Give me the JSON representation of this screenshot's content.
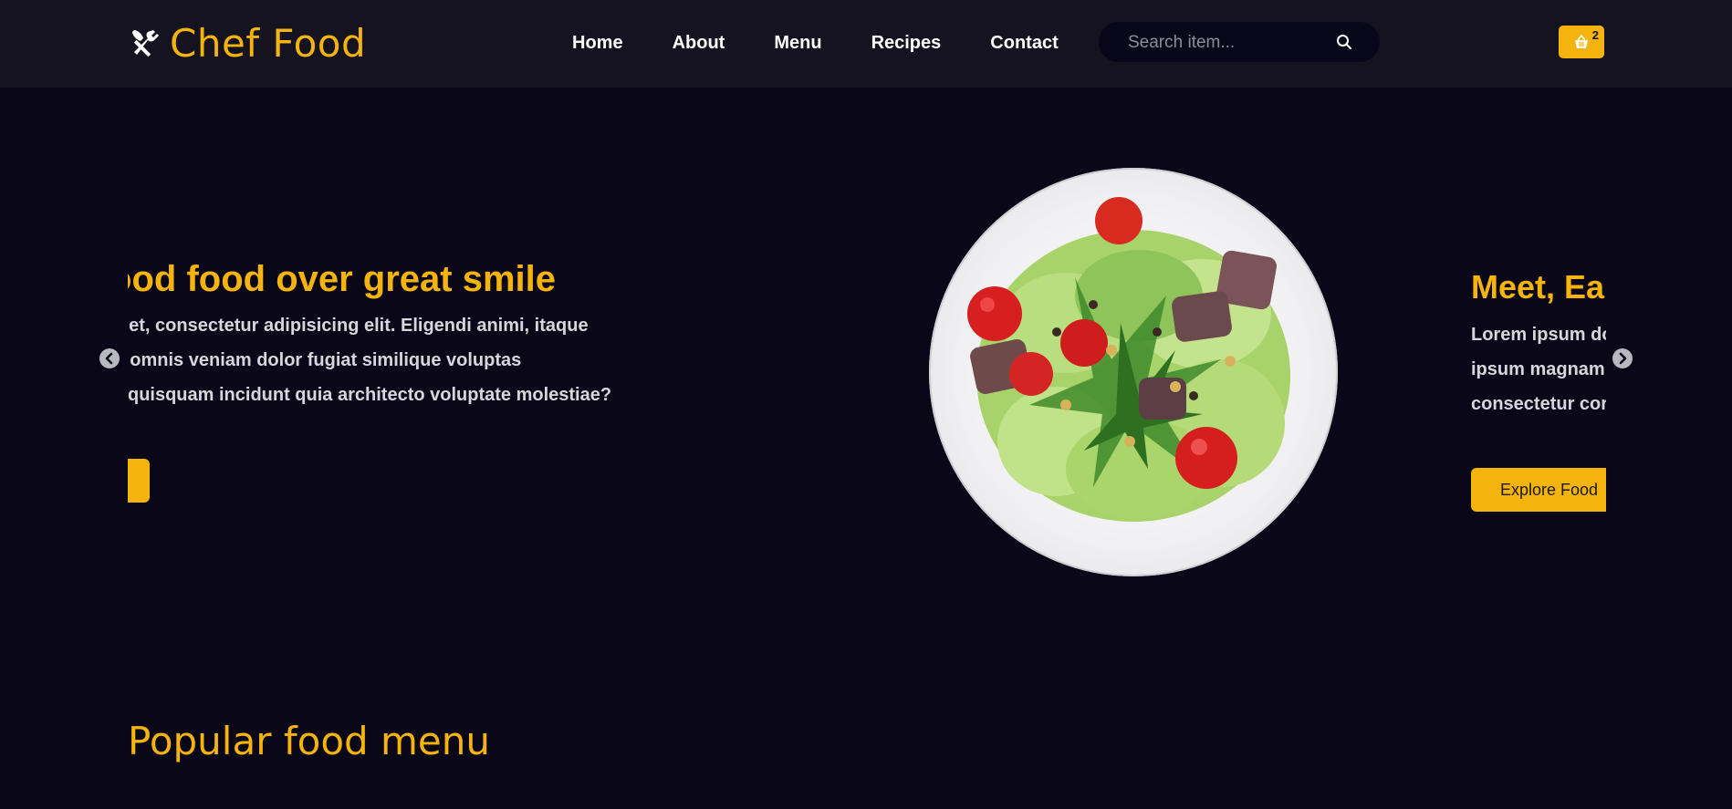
{
  "brand": {
    "name": "Chef Food",
    "icon": "fork-knife-icon"
  },
  "nav": {
    "links": [
      "Home",
      "About",
      "Menu",
      "Recipes",
      "Contact"
    ]
  },
  "search": {
    "placeholder": "Search item...",
    "icon": "search-icon"
  },
  "cart": {
    "icon": "basket-icon",
    "count": "2"
  },
  "slider": {
    "slides": [
      {
        "title": "ve good food over great smile",
        "lines": [
          "olor sit amet, consectetur adipisicing elit. Eligendi animi, itaque",
          "quae alias omnis veniam dolor fugiat similique voluptas",
          "rrupti odit quisquam incidunt quia architecto voluptate molestiae?"
        ]
      },
      {
        "title": "Meet, Ea",
        "lines": [
          "Lorem ipsum do",
          "ipsum magnam",
          "consectetur cor"
        ],
        "button": "Explore Food"
      }
    ],
    "prev_icon": "chevron-left-icon",
    "next_icon": "chevron-right-icon"
  },
  "sections": {
    "popular_title": "Popular food menu"
  },
  "colors": {
    "accent": "#f5b30d",
    "background": "#0a0818",
    "navbar": "#14131f"
  }
}
